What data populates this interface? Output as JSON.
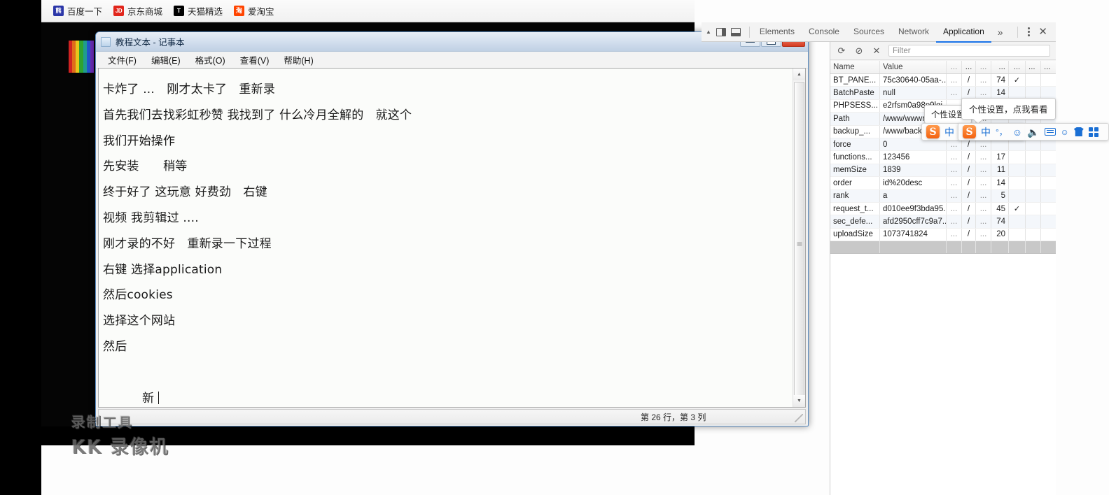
{
  "bookmarks": {
    "items": [
      {
        "icon": "baidu-icon",
        "icon_text": "熊",
        "label": "百度一下"
      },
      {
        "icon": "jd-icon",
        "icon_text": "JD",
        "label": "京东商城"
      },
      {
        "icon": "tmall-icon",
        "icon_text": "T",
        "label": "天猫精选"
      },
      {
        "icon": "taobao-icon",
        "icon_text": "淘",
        "label": "爱淘宝"
      }
    ]
  },
  "notepad": {
    "title": "教程文本 - 记事本",
    "menus": [
      "文件(F)",
      "编辑(E)",
      "格式(O)",
      "查看(V)",
      "帮助(H)"
    ],
    "window_buttons": {
      "minimize": "minimize",
      "maximize": "maximize",
      "close": "✕"
    },
    "lines": [
      "卡炸了 ...　刚才太卡了　重新录",
      "",
      "首先我们去找彩虹秒赞 我找到了 什么冷月全解的　就这个",
      "我们开始操作",
      "先安装　　稍等",
      "终于好了 这玩意 好费劲　右键",
      "视频 我剪辑过 ....",
      "刚才录的不好　重新录一下过程",
      "右键 选择application",
      "然后cookies",
      "选择这个网站",
      "然后",
      "新"
    ],
    "status": "第 26 行，第 3 列"
  },
  "watermark": {
    "top": "录制工具",
    "bottom": "KK 录像机"
  },
  "devtools": {
    "tabs": [
      {
        "label": "Elements",
        "active": false
      },
      {
        "label": "Console",
        "active": false
      },
      {
        "label": "Sources",
        "active": false
      },
      {
        "label": "Network",
        "active": false
      },
      {
        "label": "Application",
        "active": true
      }
    ],
    "more_tabs": "»",
    "menu_icon": "kebab-menu-icon",
    "close_icon": "✕",
    "toolbar": {
      "refresh": "⟳",
      "clear": "⊘",
      "delete": "✕",
      "filter_placeholder": "Filter"
    },
    "cookie_table": {
      "headers": [
        "Name",
        "Value",
        "...",
        "...",
        "...",
        "...",
        "...",
        "...",
        "...",
        "..."
      ],
      "rows": [
        {
          "name": "BT_PANE...",
          "value": "75c30640-05aa-...",
          "domain": "...",
          "path": "/",
          "expires": "...",
          "size": "74",
          "httponly": "✓",
          "secure": "",
          "samesite": ""
        },
        {
          "name": "BatchPaste",
          "value": "null",
          "domain": "...",
          "path": "/",
          "expires": "...",
          "size": "14",
          "httponly": "",
          "secure": "",
          "samesite": ""
        },
        {
          "name": "PHPSESS...",
          "value": "e2rfsm0a98p9lgi",
          "domain": "...",
          "path": "/",
          "expires": "...",
          "size": "",
          "httponly": "",
          "secure": "",
          "samesite": ""
        },
        {
          "name": "Path",
          "value": "/www/wwwroot",
          "domain": "...",
          "path": "/",
          "expires": "...",
          "size": "",
          "httponly": "",
          "secure": "",
          "samesite": ""
        },
        {
          "name": "backup_...",
          "value": "/www/backup",
          "domain": "...",
          "path": "/",
          "expires": "...",
          "size": "",
          "httponly": "",
          "secure": "",
          "samesite": ""
        },
        {
          "name": "force",
          "value": "0",
          "domain": "...",
          "path": "/",
          "expires": "...",
          "size": "",
          "httponly": "",
          "secure": "",
          "samesite": ""
        },
        {
          "name": "functions...",
          "value": "123456",
          "domain": "...",
          "path": "/",
          "expires": "...",
          "size": "17",
          "httponly": "",
          "secure": "",
          "samesite": ""
        },
        {
          "name": "memSize",
          "value": "1839",
          "domain": "...",
          "path": "/",
          "expires": "...",
          "size": "11",
          "httponly": "",
          "secure": "",
          "samesite": ""
        },
        {
          "name": "order",
          "value": "id%20desc",
          "domain": "...",
          "path": "/",
          "expires": "...",
          "size": "14",
          "httponly": "",
          "secure": "",
          "samesite": ""
        },
        {
          "name": "rank",
          "value": "a",
          "domain": "...",
          "path": "/",
          "expires": "...",
          "size": "5",
          "httponly": "",
          "secure": "",
          "samesite": ""
        },
        {
          "name": "request_t...",
          "value": "d010ee9f3bda95...",
          "domain": "...",
          "path": "/",
          "expires": "...",
          "size": "45",
          "httponly": "✓",
          "secure": "",
          "samesite": ""
        },
        {
          "name": "sec_defe...",
          "value": "afd2950cff7c9a7...",
          "domain": "...",
          "path": "/",
          "expires": "...",
          "size": "74",
          "httponly": "",
          "secure": "",
          "samesite": ""
        },
        {
          "name": "uploadSize",
          "value": "1073741824",
          "domain": "...",
          "path": "/",
          "expires": "...",
          "size": "20",
          "httponly": "",
          "secure": "",
          "samesite": ""
        }
      ]
    }
  },
  "ime": {
    "back": {
      "logo": "S",
      "mode": "中",
      "tooltip": "个性设置"
    },
    "front": {
      "logo": "S",
      "mode": "中",
      "punct": "°，",
      "emoji": "☺",
      "mic": "•",
      "keyboard": "keyboard-icon",
      "user": "user-icon",
      "skin": "skin-icon",
      "toolbox": "toolbox-icon",
      "tooltip": "个性设置，点我看看"
    }
  },
  "colors": {
    "accent": "#1a73e8",
    "ime_blue": "#1a6fd4",
    "sogou_orange": "#f4610f",
    "close_red": "#d63b20",
    "backdrop": "#000000"
  }
}
